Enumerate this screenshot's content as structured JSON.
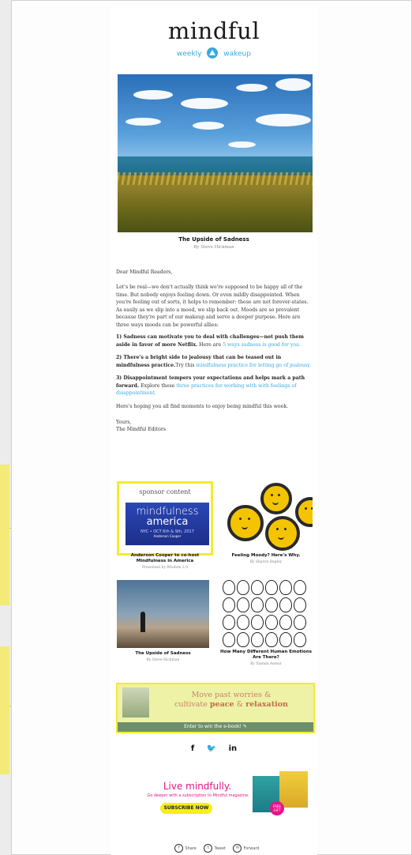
{
  "header": {
    "logo": "mindful",
    "tagline_left": "weekly",
    "tagline_right": "wakeup"
  },
  "article": {
    "title": "The Upside of Sadness",
    "byline": "By Steve Hickman"
  },
  "letter": {
    "greeting": "Dear Mindful Readers,",
    "intro": "Let's be real—we don't actually think we're supposed to be happy all of the time. But nobody enjoys feeling down. Or even mildly disappointed. When you're feeling out of sorts, it helps to remember: these are not forever-states. As easily as we slip into a mood, we slip back out. Moods are so prevalent because they're part of our makeup and serve a deeper purpose. Here are three ways moods can be powerful allies:",
    "point1_bold": "1) Sadness can motivate you to deal with challenges—not push them aside in favor of more Netflix.",
    "point1_text": " Here are ",
    "point1_link": "5 ways sadness is good for you.",
    "point2_bold": "2) There's a bright side to jealousy that can be teased out in mindfulness practice.",
    "point2_text": "Try this ",
    "point2_link": "mindfulness practice for letting go of jealousy.",
    "point3_bold": "3) Disappointment tempers your expectations and helps mark a path forward.",
    "point3_text": " Explore these ",
    "point3_link": "three practices for working with with feelings of disappointment.",
    "closing": "Here's hoping you all find moments to enjoy being mindful this week.",
    "signoff1": "Yours,",
    "signoff2": "The Mindful Editors"
  },
  "tiles": [
    {
      "label": "sponsor content",
      "img_line1": "mindfulness",
      "img_line2": "america",
      "img_line3": "NYC • OCT 6th & 9th, 2017",
      "img_line4": "Anderson Cooper",
      "title": "Anderson Cooper to co-host Mindfulness in America",
      "byline": "Presented by Wisdom 2.0"
    },
    {
      "title": "Feeling Moody? Here's Why.",
      "byline": "By Sharon Begley"
    },
    {
      "title": "The Upside of Sadness",
      "byline": "By Steve Hickman"
    },
    {
      "title": "How Many Different Human Emotions Are There?",
      "byline": "By Yasmin Anwar"
    }
  ],
  "banner": {
    "line1": "Move past worries &",
    "line2_pre": "cultivate ",
    "line2_b1": "peace",
    "line2_mid": " & ",
    "line2_b2": "relaxation",
    "cta": "Enter to win the e-book! ✎"
  },
  "social": {
    "facebook": "f",
    "twitter": "🐦",
    "linkedin": "in"
  },
  "subscribe": {
    "title": "Live mindfully.",
    "desc": "Go deeper with a subscription to Mindful magazine.",
    "button": "SUBSCRIBE NOW",
    "gift": "FREE GIFT"
  },
  "footer": {
    "share": "Share",
    "tweet": "Tweet",
    "forward": "Forward"
  },
  "colors": {
    "accent": "#35a9e0",
    "highlight": "#f4ec2e",
    "magenta": "#e6138a"
  }
}
